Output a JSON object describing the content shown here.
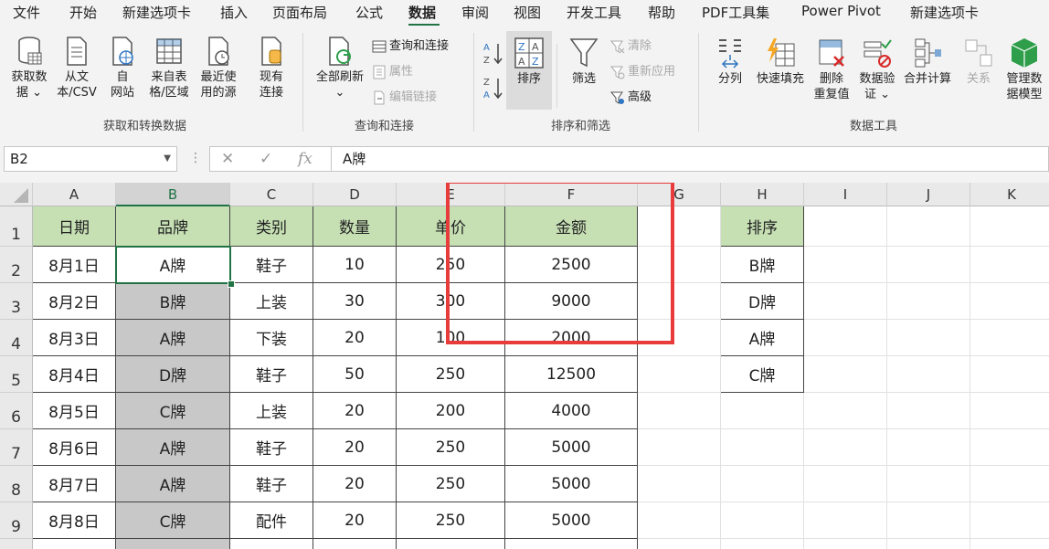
{
  "menu": {
    "tabs": [
      "文件",
      "开始",
      "新建选项卡",
      "插入",
      "页面布局",
      "公式",
      "数据",
      "审阅",
      "视图",
      "开发工具",
      "帮助",
      "PDF工具集",
      "Power Pivot",
      "新建选项卡"
    ],
    "active": "数据"
  },
  "ribbon": {
    "groups": {
      "get_transform": "获取和转换数据",
      "queries": "查询和连接",
      "sort_filter": "排序和筛选",
      "data_tools": "数据工具"
    },
    "get_data": "获取数\n据 ⌄",
    "from_text": "从文\n本/CSV",
    "from_web": "自\n网站",
    "from_table": "来自表\n格/区域",
    "recent_sources": "最近使\n用的源",
    "existing_conn": "现有\n连接",
    "refresh_all": "全部刷新\n⌄",
    "queries_conn": "查询和连接",
    "properties": "属性",
    "edit_links": "编辑链接",
    "sort_az": "A→Z",
    "sort_za": "Z→A",
    "sort": "排序",
    "filter": "筛选",
    "clear": "清除",
    "reapply": "重新应用",
    "advanced": "高级",
    "text_to_columns": "分列",
    "flash_fill": "快速填充",
    "remove_dup": "删除\n重复值",
    "data_validation": "数据验\n证 ⌄",
    "consolidate": "合并计算",
    "relationships": "关系",
    "data_model": "管理数\n据模型"
  },
  "formula_bar": {
    "name_box": "B2",
    "value": "A牌"
  },
  "columns": [
    "A",
    "B",
    "C",
    "D",
    "E",
    "F",
    "G",
    "H",
    "I",
    "J",
    "K"
  ],
  "rows": [
    "1",
    "2",
    "3",
    "4",
    "5",
    "6",
    "7",
    "8",
    "9"
  ],
  "table": {
    "headers": [
      "日期",
      "品牌",
      "类别",
      "数量",
      "单价",
      "金额"
    ],
    "rows": [
      [
        "8月1日",
        "A牌",
        "鞋子",
        "10",
        "250",
        "2500"
      ],
      [
        "8月2日",
        "B牌",
        "上装",
        "30",
        "300",
        "9000"
      ],
      [
        "8月3日",
        "A牌",
        "下装",
        "20",
        "100",
        "2000"
      ],
      [
        "8月4日",
        "D牌",
        "鞋子",
        "50",
        "250",
        "12500"
      ],
      [
        "8月5日",
        "C牌",
        "上装",
        "20",
        "200",
        "4000"
      ],
      [
        "8月6日",
        "A牌",
        "鞋子",
        "20",
        "250",
        "5000"
      ],
      [
        "8月7日",
        "A牌",
        "鞋子",
        "20",
        "250",
        "5000"
      ],
      [
        "8月8日",
        "C牌",
        "配件",
        "20",
        "250",
        "5000"
      ]
    ]
  },
  "sort_list": {
    "header": "排序",
    "items": [
      "B牌",
      "D牌",
      "A牌",
      "C牌"
    ]
  },
  "colors": {
    "accent": "#217346",
    "header_fill": "#c6e0b4",
    "highlight": "#e83b3b",
    "selection_fill": "#c8c8c8"
  }
}
